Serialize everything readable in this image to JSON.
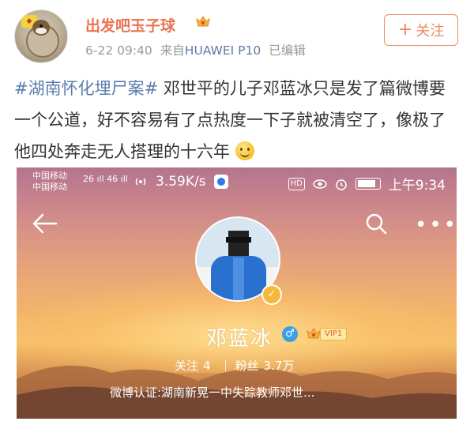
{
  "post_header": {
    "username": "出发吧玉子球",
    "date": "6-22 09:40",
    "source_prefix": "来自",
    "device": "HUAWEI P10",
    "edited": "已编辑",
    "follow_label": "关注",
    "follow_plus": "+"
  },
  "post": {
    "topic": "#湖南怀化埋尸案#",
    "body": " 邓世平的儿子邓蓝冰只是发了篇微博要一个公道，好不容易有了点热度一下子就被清空了，像极了他四处奔走无人搭理的十六年"
  },
  "embedded_screenshot": {
    "status_bar": {
      "carrier_1": "中国移动",
      "carrier_2": "中国移动",
      "signal_1": "26 ıll",
      "signal_2": "46 ıll",
      "speed": "3.59K/s",
      "hd": "HD",
      "time": "上午9:34"
    },
    "profile": {
      "name": "邓蓝冰",
      "vip_label": "VIP1",
      "following_label": "关注",
      "following_count": "4",
      "followers_label": "粉丝",
      "followers_count": "3.7万",
      "verification": "微博认证:湖南新晃一中失踪教师邓世..."
    }
  },
  "colors": {
    "username": "#eb7350",
    "topic": "#5a7dac",
    "follow": "#f08a5d",
    "meta": "#999999",
    "device": "#5f7ba3"
  },
  "icons": [
    "back-arrow-icon",
    "search-icon",
    "more-icon",
    "crown-icon",
    "verified-icon",
    "gender-icon",
    "vip-icon",
    "smile-emoji-icon"
  ]
}
